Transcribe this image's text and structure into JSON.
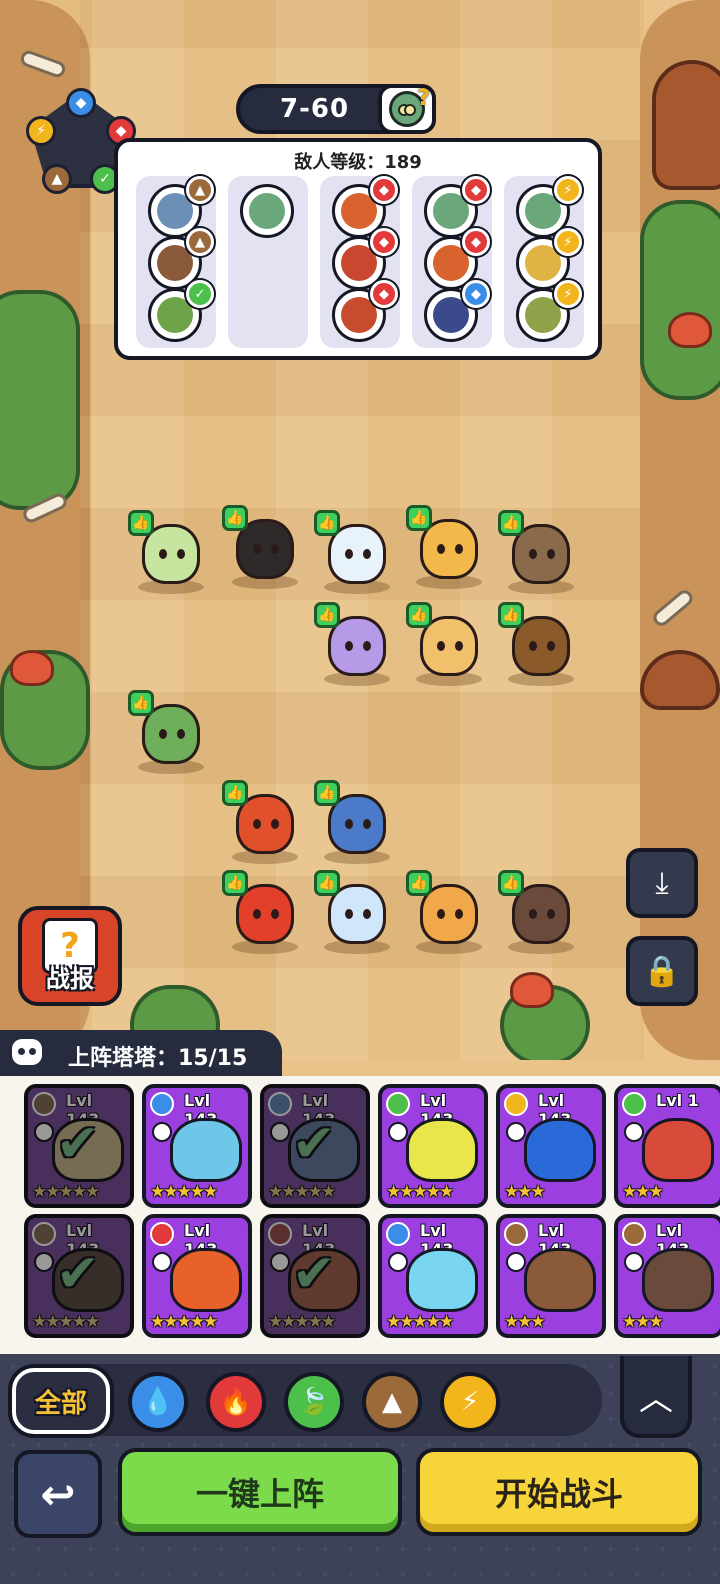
{
  "stage": {
    "label": "7-60"
  },
  "enemies": {
    "title": "敌人等级：189",
    "columns": [
      {
        "heads": [
          {
            "color": "#6b8fb5",
            "element": "earth"
          },
          {
            "color": "#8b5a3a",
            "element": "earth"
          },
          {
            "color": "#6fa34a",
            "element": "nature"
          }
        ]
      },
      {
        "heads": [
          {
            "color": "#6aa77a",
            "element": ""
          }
        ]
      },
      {
        "heads": [
          {
            "color": "#d8632e",
            "element": "fire"
          },
          {
            "color": "#c8472e",
            "element": "fire"
          },
          {
            "color": "#c84b2e",
            "element": "fire"
          }
        ]
      },
      {
        "heads": [
          {
            "color": "#6aa77a",
            "element": "fire"
          },
          {
            "color": "#d8632e",
            "element": "fire"
          },
          {
            "color": "#3a4a8a",
            "element": "water"
          }
        ]
      },
      {
        "heads": [
          {
            "color": "#6aa77a",
            "element": "lightning"
          },
          {
            "color": "#e0b444",
            "element": "lightning"
          },
          {
            "color": "#8ea34a",
            "element": "lightning"
          }
        ]
      }
    ]
  },
  "element_colors": {
    "water": "#3a8ee8",
    "fire": "#e23a3a",
    "nature": "#4cc04a",
    "earth": "#9a6a3a",
    "lightning": "#f2b51b"
  },
  "field_units": [
    {
      "name": "pink-mantis",
      "color": "#c6e6a0"
    },
    {
      "name": "fire-fox",
      "color": "#2e2a2a"
    },
    {
      "name": "panda-bear",
      "color": "#e8f2fa"
    },
    {
      "name": "golden-cat",
      "color": "#f2b84a"
    },
    {
      "name": "raccoon-gunner",
      "color": "#8a6a4a"
    },
    {
      "name": "star-fox",
      "color": "#b69ae8"
    },
    {
      "name": "sand-cat",
      "color": "#f0c06a"
    },
    {
      "name": "rock-turtle",
      "color": "#8a5a2a"
    },
    {
      "name": "leaf-frog",
      "color": "#6fae5a"
    },
    {
      "name": "flame-bird",
      "color": "#e0502a"
    },
    {
      "name": "blue-bear",
      "color": "#4a7ac8"
    },
    {
      "name": "red-salamander",
      "color": "#e2402a"
    },
    {
      "name": "ice-ghost",
      "color": "#cfe6fb"
    },
    {
      "name": "horn-goat",
      "color": "#f0a84a"
    },
    {
      "name": "wild-boar",
      "color": "#6a4a3a"
    }
  ],
  "side_buttons": {
    "report_label": "战报",
    "report_icon": "?",
    "download_icon": "download-icon",
    "lock_icon": "lock-icon"
  },
  "roster": {
    "title": "上阵塔塔：15/15",
    "cards": [
      {
        "level": "Lvl 143",
        "element": "earth",
        "art": "#d9b45a",
        "stars": "★★★★★",
        "used": true
      },
      {
        "level": "Lvl 143",
        "element": "water",
        "art": "#6ec6e8",
        "stars": "★★★★★",
        "used": false
      },
      {
        "level": "Lvl 143",
        "element": "water",
        "art": "#4a7ac8",
        "stars": "★★★★★",
        "used": true
      },
      {
        "level": "Lvl 143",
        "element": "nature",
        "art": "#e8e64a",
        "stars": "★★★★★",
        "used": false
      },
      {
        "level": "Lvl 143",
        "element": "lightning",
        "art": "#2a6ad8",
        "stars": "★★★",
        "used": false
      },
      {
        "level": "Lvl 1",
        "element": "nature",
        "art": "#d84a3a",
        "stars": "★★★",
        "used": false
      },
      {
        "level": "Lvl 143",
        "element": "earth",
        "art": "#6a4a3a",
        "stars": "★★★★★",
        "used": true
      },
      {
        "level": "Lvl 143",
        "element": "fire",
        "art": "#e8602a",
        "stars": "★★★★★",
        "used": false
      },
      {
        "level": "Lvl 143",
        "element": "fire",
        "art": "#e0502a",
        "stars": "★★★★★",
        "used": true
      },
      {
        "level": "Lvl 143",
        "element": "water",
        "art": "#7ad6f0",
        "stars": "★★★★★",
        "used": false
      },
      {
        "level": "Lvl 143",
        "element": "earth",
        "art": "#8a5a3a",
        "stars": "★★★",
        "used": false
      },
      {
        "level": "Lvl 143",
        "element": "earth",
        "art": "#6a4a3a",
        "stars": "★★★",
        "used": false
      }
    ]
  },
  "filters": {
    "all_label": "全部",
    "buttons": [
      {
        "element": "water",
        "glyph": "💧"
      },
      {
        "element": "fire",
        "glyph": "🔥"
      },
      {
        "element": "nature",
        "glyph": "🍃"
      },
      {
        "element": "earth",
        "glyph": "▲"
      },
      {
        "element": "lightning",
        "glyph": "⚡"
      }
    ],
    "collapse_icon": "︿"
  },
  "actions": {
    "back_icon": "↩",
    "auto_deploy": "一键上阵",
    "start_battle": "开始战斗"
  }
}
